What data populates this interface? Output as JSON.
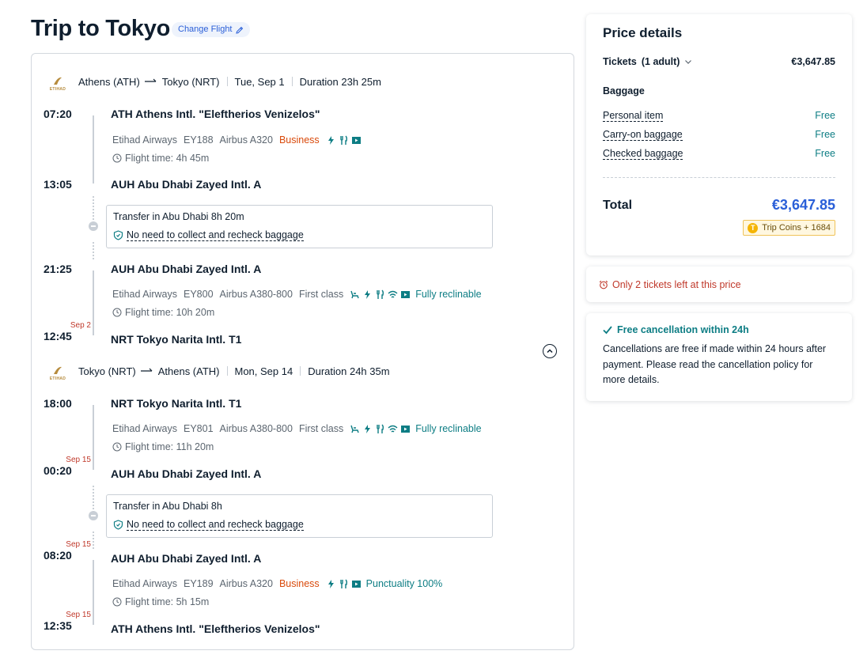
{
  "page": {
    "title": "Trip to Tokyo",
    "change_flight": "Change Flight"
  },
  "outbound": {
    "route_from": "Athens (ATH)",
    "route_to": "Tokyo (NRT)",
    "date": "Tue, Sep 1",
    "duration": "Duration 23h 25m",
    "segments": [
      {
        "dep_time": "07:20",
        "dep_airport": "ATH Athens Intl. \"Eleftherios Venizelos\"",
        "airline": "Etihad Airways",
        "flight_no": "EY188",
        "aircraft": "Airbus A320",
        "cabin": "Business",
        "flight_time": "Flight time: 4h 45m",
        "arr_time": "13:05",
        "arr_airport": "AUH Abu Dhabi Zayed Intl. A"
      },
      {
        "dep_time": "21:25",
        "dep_airport": "AUH Abu Dhabi Zayed Intl. A",
        "airline": "Etihad Airways",
        "flight_no": "EY800",
        "aircraft": "Airbus A380-800",
        "cabin": "First class",
        "seat_feature": "Fully reclinable",
        "flight_time": "Flight time: 10h 20m",
        "arr_date": "Sep 2",
        "arr_time": "12:45",
        "arr_airport": "NRT Tokyo Narita Intl. T1"
      }
    ],
    "transfer": {
      "label": "Transfer in Abu Dhabi  8h 20m",
      "baggage_note": "No need to collect and recheck baggage"
    }
  },
  "return": {
    "route_from": "Tokyo (NRT)",
    "route_to": "Athens (ATH)",
    "date": "Mon, Sep 14",
    "duration": "Duration 24h 35m",
    "segments": [
      {
        "dep_time": "18:00",
        "dep_airport": "NRT Tokyo Narita Intl. T1",
        "airline": "Etihad Airways",
        "flight_no": "EY801",
        "aircraft": "Airbus A380-800",
        "cabin": "First class",
        "seat_feature": "Fully reclinable",
        "flight_time": "Flight time: 11h 20m",
        "arr_date": "Sep 15",
        "arr_time": "00:20",
        "arr_airport": "AUH Abu Dhabi Zayed Intl. A"
      },
      {
        "dep_date": "Sep 15",
        "dep_time": "08:20",
        "dep_airport": "AUH Abu Dhabi Zayed Intl. A",
        "airline": "Etihad Airways",
        "flight_no": "EY189",
        "aircraft": "Airbus A320",
        "cabin": "Business",
        "punctuality": "Punctuality 100%",
        "flight_time": "Flight time: 5h 15m",
        "arr_date": "Sep 15",
        "arr_time": "12:35",
        "arr_airport": "ATH Athens Intl. \"Eleftherios Venizelos\""
      }
    ],
    "transfer": {
      "label": "Transfer in Abu Dhabi  8h",
      "baggage_note": "No need to collect and recheck baggage"
    }
  },
  "airline_logo_text": "ETIHAD",
  "price": {
    "title": "Price details",
    "tickets_label": "Tickets",
    "tickets_count": "(1 adult)",
    "tickets_value": "€3,647.85",
    "baggage_heading": "Baggage",
    "baggage": [
      {
        "label": "Personal item",
        "value": "Free"
      },
      {
        "label": "Carry-on baggage",
        "value": "Free"
      },
      {
        "label": "Checked baggage",
        "value": "Free"
      }
    ],
    "total_label": "Total",
    "total_value": "€3,647.85",
    "coins_icon": "T",
    "coins": "Trip Coins + 1684"
  },
  "alert": {
    "text": "Only 2 tickets left at this price"
  },
  "cancellation": {
    "title": "Free cancellation within 24h",
    "body": "Cancellations are free if made within 24 hours after payment. Please read the cancellation policy for more details."
  },
  "colors": {
    "accent_blue": "#2a5fd8",
    "teal": "#0d7d84",
    "business_orange": "#d94a0b",
    "alert_red": "#c0392b"
  },
  "icons": [
    "edit-icon",
    "airline-logo",
    "arrow-right-icon",
    "clock-icon",
    "power-icon",
    "meal-icon",
    "entertainment-icon",
    "seat-icon",
    "wifi-icon",
    "shield-icon",
    "chevron-up-icon",
    "chevron-down-icon",
    "alarm-icon",
    "check-icon",
    "coin-icon"
  ]
}
